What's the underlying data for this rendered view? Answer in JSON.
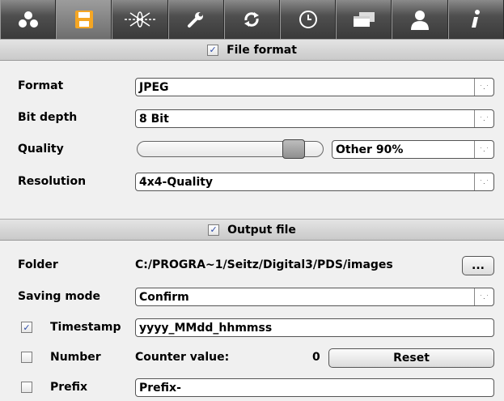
{
  "toolbar": {
    "buttons": [
      {
        "icon": "color-dots-icon",
        "active": false
      },
      {
        "icon": "save-icon",
        "active": true,
        "accent": "#f5a623"
      },
      {
        "icon": "lens-path-icon",
        "active": false
      },
      {
        "icon": "wrench-icon",
        "active": false
      },
      {
        "icon": "refresh-icon",
        "active": false
      },
      {
        "icon": "clock-icon",
        "active": false
      },
      {
        "icon": "window-icon",
        "active": false
      },
      {
        "icon": "user-icon",
        "active": false
      },
      {
        "icon": "info-icon",
        "active": false
      }
    ]
  },
  "file_format": {
    "header": "File format",
    "checked": true,
    "format_label": "Format",
    "format_value": "JPEG",
    "bit_depth_label": "Bit depth",
    "bit_depth_value": "8 Bit",
    "quality_label": "Quality",
    "quality_slider_fraction": 0.9,
    "quality_value": "Other 90%",
    "resolution_label": "Resolution",
    "resolution_value": "4x4-Quality"
  },
  "output_file": {
    "header": "Output file",
    "checked": true,
    "folder_label": "Folder",
    "folder_value": "C:/PROGRA~1/Seitz/Digital3/PDS/images",
    "browse_label": "...",
    "saving_mode_label": "Saving mode",
    "saving_mode_value": "Confirm",
    "timestamp_label": "Timestamp",
    "timestamp_checked": true,
    "timestamp_value": "yyyy_MMdd_hhmmss",
    "number_label": "Number",
    "number_checked": false,
    "counter_label": "Counter value:",
    "counter_value": "0",
    "reset_label": "Reset",
    "prefix_label": "Prefix",
    "prefix_checked": false,
    "prefix_value": "Prefix-"
  }
}
